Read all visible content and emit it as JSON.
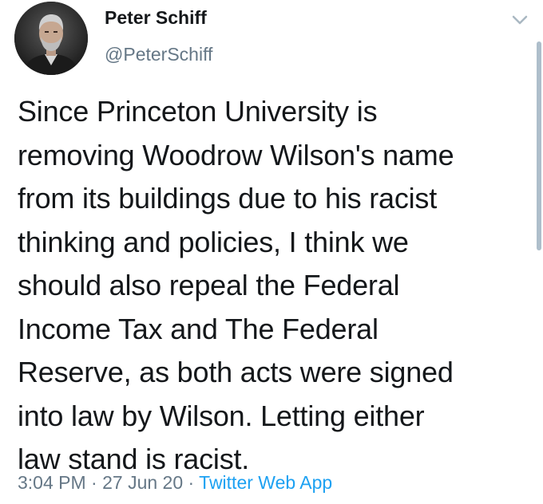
{
  "tweet": {
    "author": {
      "display_name": "Peter Schiff",
      "handle": "@PeterSchiff",
      "avatar_icon": "profile-photo"
    },
    "menu_icon": "chevron-down-icon",
    "text": "Since Princeton University is\nremoving Woodrow Wilson's name\nfrom its buildings due to his racist\nthinking and policies, I think we\nshould also repeal the Federal\nIncome Tax and The Federal\nReserve, as both acts were signed\ninto law by Wilson. Letting either\nlaw stand is racist.",
    "time": "3:04 PM",
    "separator": " · ",
    "date": "27 Jun 20",
    "source": "Twitter Web App"
  },
  "colors": {
    "primary_text": "#14171a",
    "secondary_text": "#657786",
    "link": "#1da1f2",
    "scrollbar": "#aebecb"
  }
}
